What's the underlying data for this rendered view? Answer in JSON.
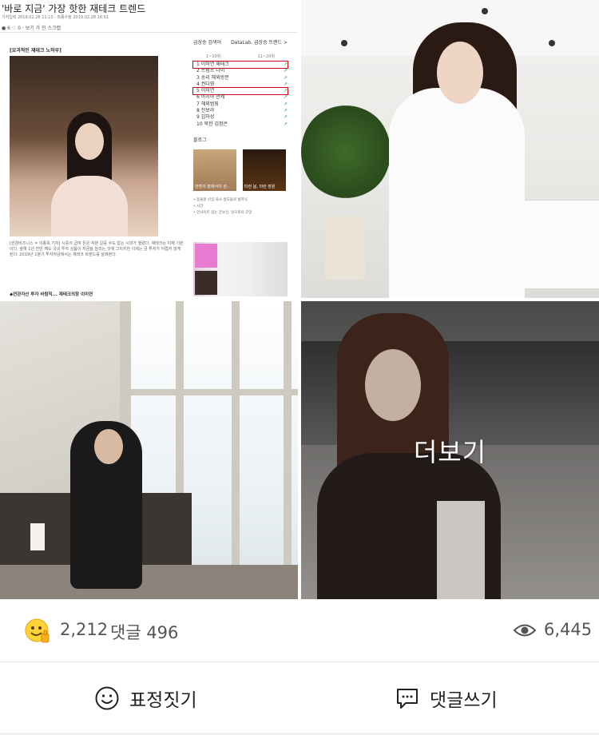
{
  "article": {
    "title": "'바로 지금' 가장 핫한 재테크 트렌드",
    "meta": "기자입력 2019.02.28 11:13 · 최종수정 2019.02.28 16:51",
    "tools": "● 6   ♡ 0   ·  보기  가  인  스크랩",
    "section_heading": "[요괴적인 재테크 노하우]",
    "body": "[한경비즈니스 = 이종옥 기자] 시중의 급여 돈은 자본 갈증 수도 없는 시대가 열렸다. 재테크는 이제 기본이다. 올해 1년 전만 해도 국내 투자 상품이 자금을 늘리는 것에 그치지만 이제는 금 투자가 어렵지 않게 된다. 2019년 1분기 투자자금에서는 재테크 트렌드를 살펴본다.",
    "footer": "◆연관자산 투자 바람직... 재테크의창 이미연"
  },
  "sidebar": {
    "title": "급상승 검색어",
    "datalab": "DataLab. 급상승 트렌드 >",
    "tabs": [
      "1~10위",
      "11~20위"
    ],
    "ranks": [
      {
        "label": "1  이미연 재테크",
        "highlight": true
      },
      {
        "label": "2  트럼프 나이",
        "highlight": false
      },
      {
        "label": "3  승리 해외방문",
        "highlight": false
      },
      {
        "label": "4  권다영",
        "highlight": false
      },
      {
        "label": "5  이미연",
        "highlight": true
      },
      {
        "label": "6  아시아 관세",
        "highlight": false
      },
      {
        "label": "7  해외범죄",
        "highlight": false
      },
      {
        "label": "8  진보라",
        "highlight": false
      },
      {
        "label": "9  김하성",
        "highlight": false
      },
      {
        "label": "10 북한 김정은",
        "highlight": false
      }
    ],
    "blog_label": "블로그",
    "blog_thumbs": [
      "한편의 장례식이 관…",
      "타런 봄, 타런 장원"
    ],
    "links": [
      "• 동물원 신입 육사 생도들의 법학식",
      "• 시간",
      "• 인사이트 입는 굿보선, 일으로의 코앙"
    ]
  },
  "grid": {
    "more_label": "더보기"
  },
  "stats": {
    "like_count": "2,212",
    "comment_label": "댓글 496",
    "view_count": "6,445"
  },
  "actions": {
    "reaction_label": "표정짓기",
    "comment_write_label": "댓글쓰기"
  },
  "icons": {
    "reaction": "smiley-thumb-icon",
    "views": "eye-icon",
    "reaction_action": "smile-outline-icon",
    "comment_action": "chat-bubble-icon"
  }
}
